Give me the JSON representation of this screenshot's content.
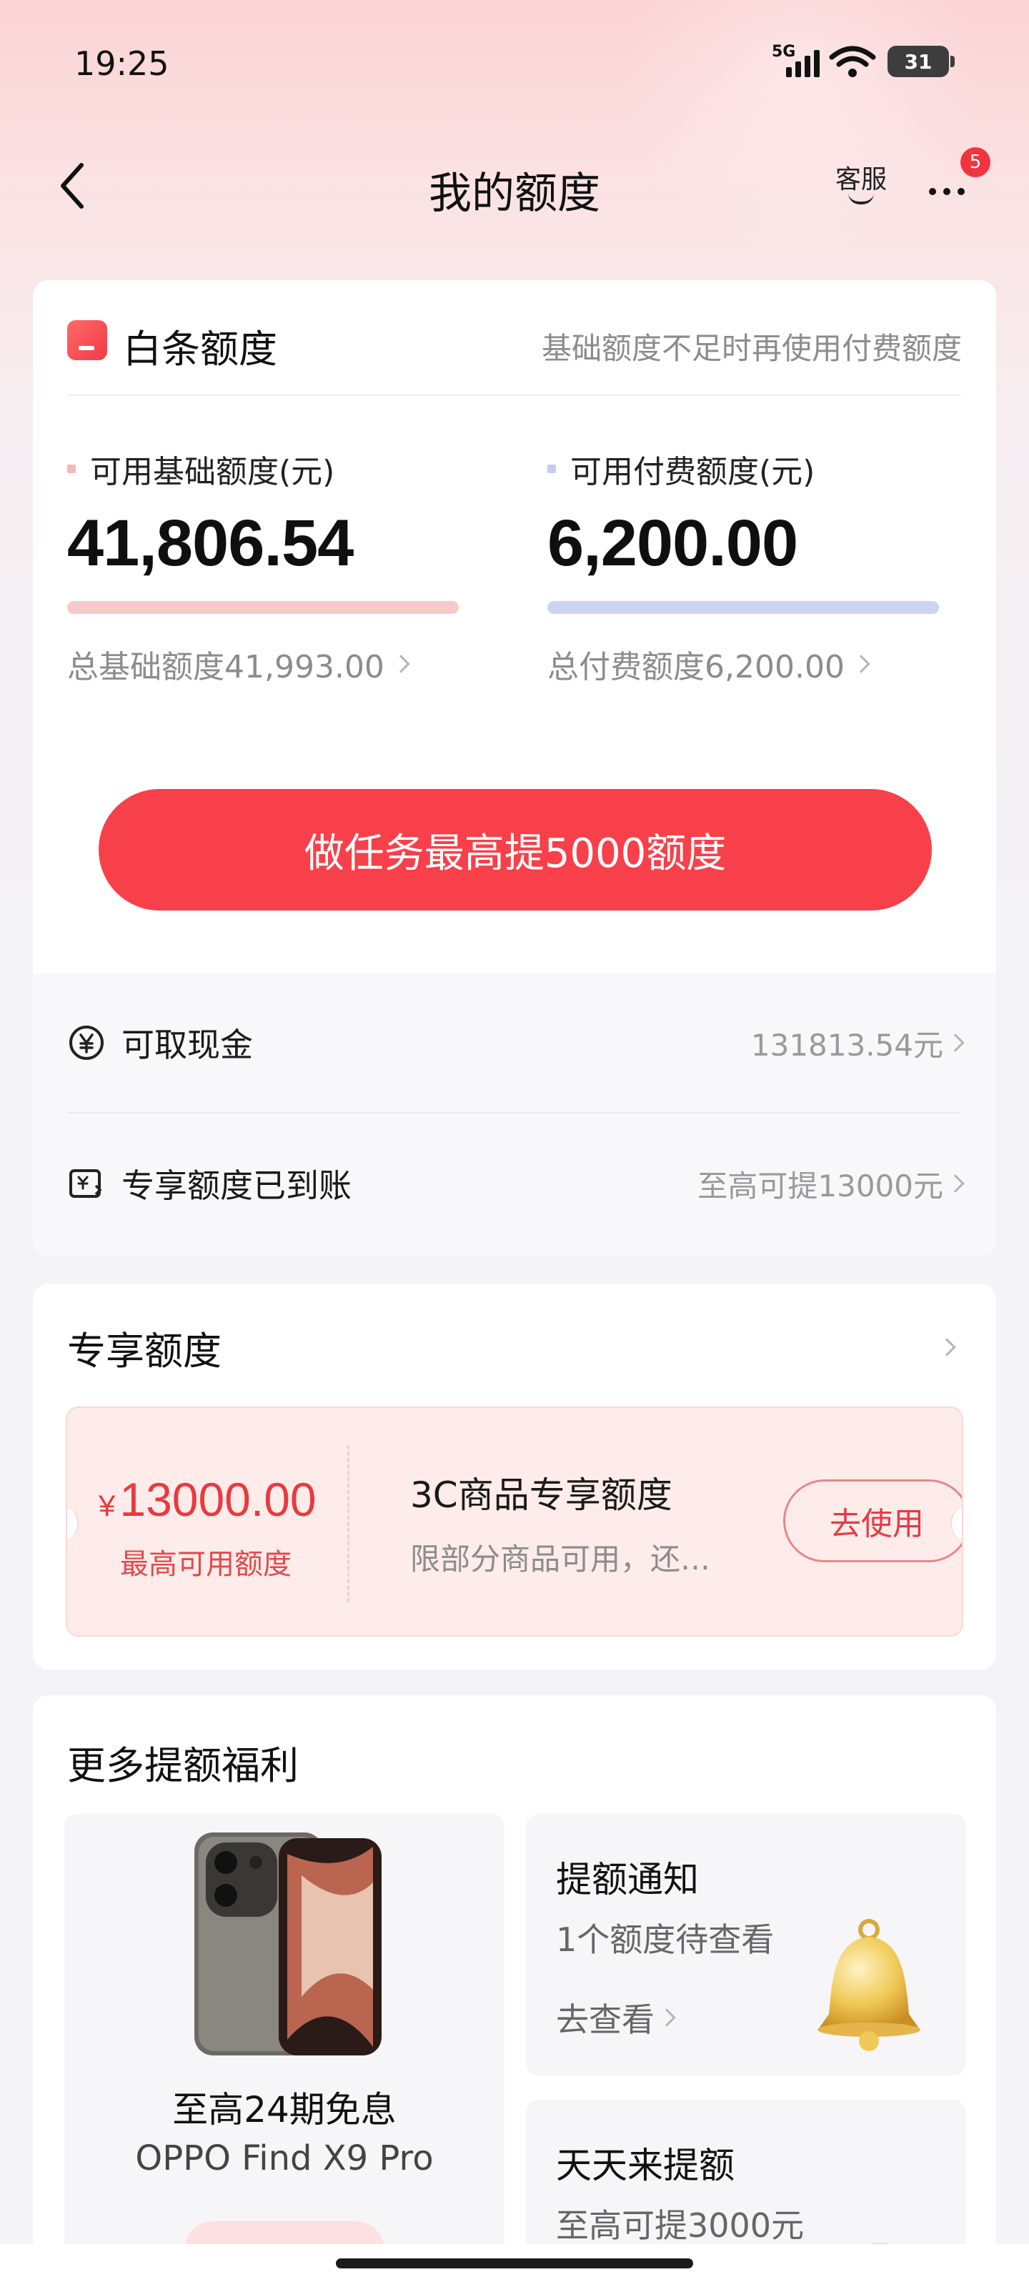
{
  "status_bar": {
    "time": "19:25",
    "network": "5G",
    "battery": "31"
  },
  "header": {
    "title": "我的额度",
    "service_label": "客服",
    "notification_count": "5"
  },
  "credit": {
    "title": "白条额度",
    "hint": "基础额度不足时再使用付费额度",
    "basic": {
      "label": "可用基础额度(元)",
      "value": "41,806.54",
      "total": "总基础额度41,993.00",
      "color": "#f8c9c9"
    },
    "paid": {
      "label": "可用付费额度(元)",
      "value": "6,200.00",
      "total": "总付费额度6,200.00",
      "color": "#cfd3f3"
    },
    "task_button": "做任务最高提5000额度",
    "rows": [
      {
        "icon": "yuan-circle-icon",
        "label": "可取现金",
        "value": "131813.54元"
      },
      {
        "icon": "exclusive-quota-icon",
        "label": "专享额度已到账",
        "value": "至高可提13000元"
      }
    ]
  },
  "exclusive": {
    "title": "专享额度",
    "coupon": {
      "currency": "¥",
      "amount": "13000.00",
      "amount_sub": "最高可用额度",
      "name": "3C商品专享额度",
      "desc": "限部分商品可用，还…",
      "button": "去使用"
    }
  },
  "more_benefits": {
    "title": "更多提额福利",
    "promo": {
      "title": "至高24期免息",
      "subtitle": "OPPO Find X9 Pro"
    },
    "benefit1": {
      "title": "提额通知",
      "subtitle": "1个额度待查看",
      "link": "去查看"
    },
    "benefit2": {
      "title": "天天来提额",
      "subtitle": "至高可提3000元"
    }
  },
  "colors": {
    "accent": "#f8404a",
    "coupon_bg": "#fdecea"
  }
}
